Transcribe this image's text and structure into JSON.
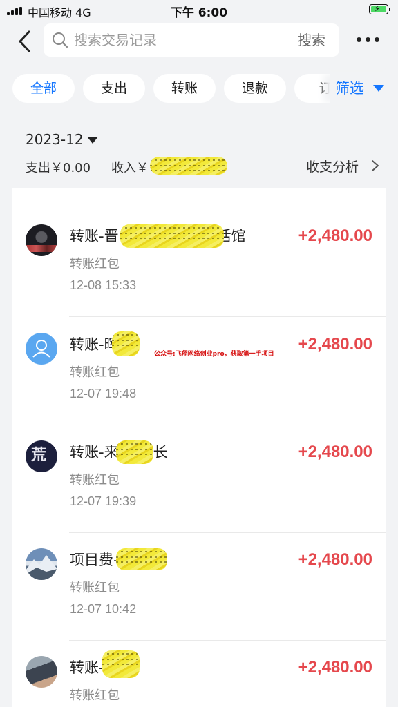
{
  "status_bar": {
    "carrier": "中国移动 4G",
    "time": "下午 6:00"
  },
  "search": {
    "placeholder": "搜索交易记录",
    "button_label": "搜索"
  },
  "filters": {
    "chips": [
      {
        "label": "全部",
        "active": true
      },
      {
        "label": "支出",
        "active": false
      },
      {
        "label": "转账",
        "active": false
      },
      {
        "label": "退款",
        "active": false
      },
      {
        "label": "订",
        "active": false
      }
    ],
    "filter_label": "筛选"
  },
  "summary": {
    "month": "2023-12",
    "expense": "支出￥0.00",
    "income_label": "收入￥",
    "analysis_label": "收支分析"
  },
  "transactions": [
    {
      "title_prefix": "转账-晋",
      "title_suffix": "活馆",
      "subtitle": "转账红包",
      "time": "12-08 15:33",
      "amount": "+2,480.00",
      "avatar": "dark-photo-avatar"
    },
    {
      "title_prefix": "转账-晖",
      "title_suffix": "",
      "subtitle": "转账红包",
      "time": "12-07 19:48",
      "amount": "+2,480.00",
      "avatar": "default-user-avatar"
    },
    {
      "title_prefix": "转账-来",
      "title_suffix": "长",
      "subtitle": "转账红包",
      "time": "12-07 19:39",
      "amount": "+2,480.00",
      "avatar": "calligraphy-avatar"
    },
    {
      "title_prefix": "项目费-",
      "title_suffix": "",
      "subtitle": "转账红包",
      "time": "12-07 10:42",
      "amount": "+2,480.00",
      "avatar": "mountain-avatar"
    },
    {
      "title_prefix": "转账-",
      "title_suffix": "",
      "subtitle": "转账红包",
      "time": "",
      "amount": "+2,480.00",
      "avatar": "car-photo-avatar"
    }
  ],
  "watermark": "公众号:飞翔网络创业pro，获取第一手项目",
  "colors": {
    "accent": "#1677ff",
    "income": "#e5484d",
    "background": "#f2f3f5"
  }
}
